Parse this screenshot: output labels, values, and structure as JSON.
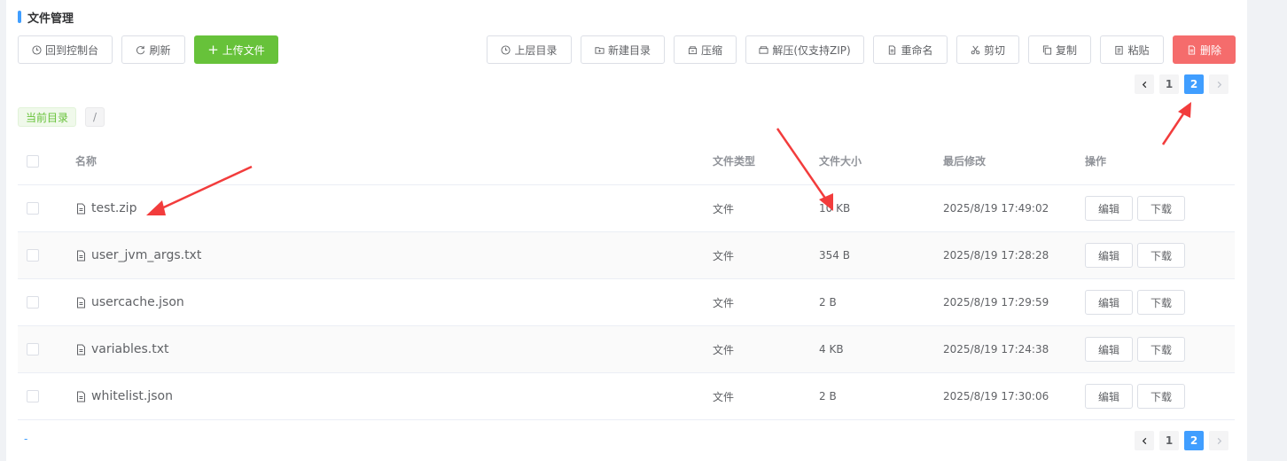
{
  "header": {
    "title": "文件管理"
  },
  "toolbar_left": [
    {
      "label": "回到控制台",
      "icon": "clock-icon"
    },
    {
      "label": "刷新",
      "icon": "refresh-icon"
    },
    {
      "label": "上传文件",
      "icon": "plus-icon"
    }
  ],
  "toolbar_right": [
    {
      "label": "上层目录",
      "icon": "clock-icon"
    },
    {
      "label": "新建目录",
      "icon": "folder-add-icon"
    },
    {
      "label": "压缩",
      "icon": "package-icon"
    },
    {
      "label": "解压(仅支持ZIP)",
      "icon": "unpack-icon"
    },
    {
      "label": "重命名",
      "icon": "document-icon"
    },
    {
      "label": "剪切",
      "icon": "scissors-icon"
    },
    {
      "label": "复制",
      "icon": "copy-icon"
    },
    {
      "label": "粘贴",
      "icon": "paste-icon"
    },
    {
      "label": "删除",
      "icon": "document-icon"
    }
  ],
  "pagination": {
    "pages": [
      "1",
      "2"
    ],
    "current": "2"
  },
  "path": {
    "label": "当前目录",
    "value": "/"
  },
  "table": {
    "headers": {
      "name": "名称",
      "type": "文件类型",
      "size": "文件大小",
      "modified": "最后修改",
      "actions": "操作"
    },
    "rows": [
      {
        "name": "test.zip",
        "type": "文件",
        "size": "10 KB",
        "modified": "2025/8/19 17:49:02"
      },
      {
        "name": "user_jvm_args.txt",
        "type": "文件",
        "size": "354 B",
        "modified": "2025/8/19 17:28:28"
      },
      {
        "name": "usercache.json",
        "type": "文件",
        "size": "2 B",
        "modified": "2025/8/19 17:29:59"
      },
      {
        "name": "variables.txt",
        "type": "文件",
        "size": "4 KB",
        "modified": "2025/8/19 17:24:38"
      },
      {
        "name": "whitelist.json",
        "type": "文件",
        "size": "2 B",
        "modified": "2025/8/19 17:30:06"
      }
    ],
    "row_actions": {
      "edit": "编辑",
      "download": "下载"
    }
  },
  "footer": {
    "marker": "-"
  },
  "colors": {
    "primary": "#409eff",
    "success": "#67c23a",
    "danger": "#f56c6c",
    "annotation": "#f23c3c"
  }
}
